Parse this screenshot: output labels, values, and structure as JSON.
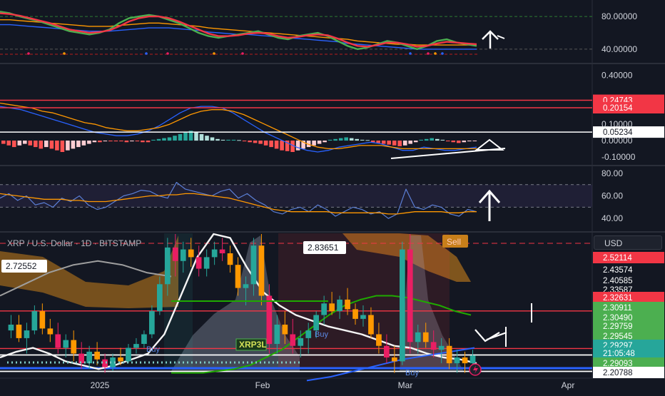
{
  "header": {
    "symbol_title": "XRP / U.S. Dollar · 1D · BITSTAMP",
    "currency": "USD"
  },
  "chart_data": [
    {
      "type": "line",
      "panel": "stochastic-oscillator",
      "ylim": [
        25,
        95
      ],
      "reference_lines": [
        80,
        40
      ],
      "tick_labels": [
        "80.00000",
        "40.00000"
      ],
      "series": [
        {
          "color": "#4caf50",
          "values": [
            86,
            84,
            80,
            77,
            74,
            70,
            66,
            62,
            60,
            58,
            60,
            64,
            72,
            78,
            80,
            82,
            80,
            76,
            72,
            66,
            60,
            56,
            54,
            56,
            58,
            60,
            62,
            58,
            54,
            52,
            56,
            58,
            60,
            56,
            50,
            44,
            40,
            42,
            46,
            50,
            48,
            44,
            40,
            44,
            50,
            52,
            48,
            46,
            44
          ]
        },
        {
          "color": "#f23645",
          "values": [
            84,
            83,
            81,
            78,
            75,
            72,
            68,
            64,
            62,
            60,
            61,
            63,
            68,
            74,
            78,
            80,
            80,
            78,
            74,
            69,
            64,
            59,
            56,
            56,
            57,
            59,
            60,
            59,
            56,
            54,
            55,
            57,
            58,
            57,
            53,
            48,
            44,
            43,
            45,
            48,
            48,
            46,
            43,
            44,
            47,
            49,
            48,
            47,
            46
          ]
        },
        {
          "color": "#2962ff",
          "values": [
            70,
            70,
            69,
            68,
            67,
            66,
            65,
            64,
            63,
            62,
            62,
            62,
            63,
            64,
            65,
            66,
            66,
            66,
            65,
            64,
            63,
            61,
            60,
            59,
            58,
            58,
            57,
            56,
            55,
            54,
            53,
            52,
            51,
            50,
            49,
            47,
            46,
            45,
            44,
            43,
            42,
            41,
            40,
            40,
            40,
            40,
            40,
            40,
            40
          ]
        },
        {
          "color": "#ff9800",
          "values": [
            76,
            76,
            75,
            74,
            73,
            72,
            71,
            70,
            69,
            68,
            68,
            68,
            69,
            70,
            71,
            72,
            72,
            71,
            70,
            69,
            68,
            66,
            65,
            64,
            63,
            62,
            61,
            60,
            59,
            58,
            57,
            56,
            55,
            54,
            53,
            52,
            50,
            49,
            48,
            47,
            46,
            46,
            45,
            45,
            45,
            45,
            45,
            45,
            45
          ]
        }
      ]
    },
    {
      "type": "bar",
      "panel": "macd",
      "ylim": [
        -0.14,
        0.46
      ],
      "tick_labels": [
        "0.40000",
        "0.10000",
        "0.00000",
        "-0.10000"
      ],
      "reference_lines": [
        {
          "value": 0.24743,
          "label": "0.24743",
          "color": "#f23645"
        },
        {
          "value": 0.20154,
          "label": "0.20154",
          "color": "#f23645"
        },
        {
          "value": 0.05234,
          "label": "0.05234",
          "color": "#ffffff"
        }
      ],
      "histogram": [
        -0.02,
        -0.03,
        -0.04,
        -0.03,
        -0.02,
        -0.03,
        -0.04,
        -0.05,
        -0.04,
        -0.05,
        -0.06,
        -0.07,
        -0.06,
        -0.05,
        -0.04,
        -0.03,
        -0.02,
        -0.01,
        -0.01,
        -0.005,
        -0.005,
        -0.005,
        -0.005,
        -0.01,
        -0.005,
        -0.005,
        -0.01,
        -0.01,
        0.005,
        0.01,
        0.015,
        0.02,
        0.03,
        0.04,
        0.05,
        0.06,
        0.055,
        0.04,
        0.03,
        0.02,
        0.01,
        0.005,
        0.005,
        0.005,
        0.003,
        -0.005,
        -0.01,
        -0.015,
        -0.02,
        -0.03,
        -0.04,
        -0.05,
        -0.06,
        -0.065,
        -0.07,
        -0.06,
        -0.05,
        -0.04,
        -0.03,
        -0.02,
        -0.01,
        0.005,
        0.01,
        0.015,
        0.02,
        0.015,
        0.01,
        0.005,
        0.003,
        -0.01,
        -0.015,
        -0.02,
        -0.025,
        -0.03,
        -0.035,
        -0.03,
        -0.02,
        -0.01,
        0.005,
        0.01,
        0.015,
        0.01,
        0.005,
        -0.005,
        -0.01,
        -0.015,
        -0.01,
        -0.005,
        -0.003
      ],
      "series": [
        {
          "color": "#2962ff",
          "values": [
            0.21,
            0.2,
            0.19,
            0.17,
            0.15,
            0.13,
            0.11,
            0.09,
            0.07,
            0.05,
            0.04,
            0.03,
            0.03,
            0.04,
            0.06,
            0.09,
            0.13,
            0.17,
            0.2,
            0.21,
            0.21,
            0.2,
            0.17,
            0.13,
            0.09,
            0.05,
            0.02,
            -0.01,
            -0.04,
            -0.06,
            -0.07,
            -0.06,
            -0.04,
            -0.03,
            -0.02,
            -0.01,
            -0.02,
            -0.04,
            -0.06,
            -0.06,
            -0.04,
            -0.05,
            -0.06,
            -0.06,
            -0.05,
            -0.04
          ]
        },
        {
          "color": "#ff9800",
          "values": [
            0.23,
            0.22,
            0.21,
            0.2,
            0.18,
            0.17,
            0.15,
            0.13,
            0.11,
            0.1,
            0.08,
            0.07,
            0.06,
            0.06,
            0.07,
            0.08,
            0.1,
            0.13,
            0.16,
            0.18,
            0.19,
            0.19,
            0.18,
            0.16,
            0.13,
            0.1,
            0.07,
            0.04,
            0.01,
            -0.02,
            -0.04,
            -0.05,
            -0.05,
            -0.04,
            -0.03,
            -0.03,
            -0.03,
            -0.04,
            -0.05,
            -0.05,
            -0.05,
            -0.05,
            -0.05,
            -0.05,
            -0.05,
            -0.05
          ]
        }
      ]
    },
    {
      "type": "line",
      "panel": "rsi",
      "ylim": [
        30,
        85
      ],
      "tick_labels": [
        "80.00",
        "60.00",
        "40.00"
      ],
      "reference_lines": [
        70,
        50
      ],
      "series": [
        {
          "color": "#5b7fd6",
          "values": [
            58,
            62,
            56,
            60,
            52,
            54,
            50,
            58,
            55,
            60,
            52,
            48,
            50,
            55,
            60,
            62,
            65,
            64,
            60,
            58,
            72,
            66,
            64,
            62,
            60,
            64,
            66,
            58,
            62,
            56,
            52,
            46,
            44,
            48,
            50,
            46,
            52,
            48,
            42,
            46,
            50,
            48,
            44,
            46,
            40,
            44,
            66,
            50,
            48,
            52,
            50,
            44,
            42,
            48,
            46
          ]
        },
        {
          "color": "#ff9800",
          "values": [
            62,
            61,
            60,
            59,
            58,
            57,
            57,
            57,
            56,
            56,
            55,
            55,
            55,
            56,
            57,
            58,
            59,
            60,
            60,
            61,
            61,
            62,
            62,
            61,
            60,
            59,
            58,
            56,
            54,
            52,
            50,
            48,
            47,
            46,
            46,
            46,
            46,
            46,
            45,
            45,
            45,
            45,
            45,
            45,
            44,
            44,
            45,
            46,
            46,
            46,
            46,
            45,
            45,
            46,
            46
          ]
        }
      ]
    },
    {
      "type": "candlestick",
      "panel": "price",
      "ylim": [
        2.18,
        2.92
      ],
      "x_ticks": [
        "2025",
        "Feb",
        "Mar",
        "Apr"
      ],
      "price_labels": [
        {
          "label": "2.52114",
          "kind": "red"
        },
        {
          "label": "2.43574",
          "kind": "plain"
        },
        {
          "label": "2.40585",
          "kind": "plain"
        },
        {
          "label": "2.33587",
          "kind": "plain"
        },
        {
          "label": "2.32631",
          "kind": "red"
        },
        {
          "label": "2.30911",
          "kind": "green"
        },
        {
          "label": "2.30490",
          "kind": "green"
        },
        {
          "label": "2.29759",
          "kind": "green"
        },
        {
          "label": "2.29545",
          "kind": "green"
        },
        {
          "label": "2.29297",
          "kind": "last"
        },
        {
          "label": "21:05:48",
          "kind": "timer"
        },
        {
          "label": "2.29093",
          "kind": "green"
        },
        {
          "label": "2.20788",
          "kind": "white"
        }
      ],
      "annotations": [
        {
          "text": "2.72552",
          "kind": "callout"
        },
        {
          "text": "2.83651",
          "kind": "callout"
        },
        {
          "text": "Sell",
          "kind": "signal"
        },
        {
          "text": "Buy",
          "kind": "signal"
        },
        {
          "text": "Buy",
          "kind": "signal"
        },
        {
          "text": "Buy",
          "kind": "signal"
        },
        {
          "text": "XRP3L",
          "kind": "tag"
        }
      ],
      "candles": [
        [
          2.42,
          2.5,
          2.38,
          2.45
        ],
        [
          2.45,
          2.5,
          2.36,
          2.38
        ],
        [
          2.38,
          2.46,
          2.3,
          2.42
        ],
        [
          2.42,
          2.55,
          2.4,
          2.52
        ],
        [
          2.52,
          2.56,
          2.4,
          2.43
        ],
        [
          2.43,
          2.48,
          2.36,
          2.4
        ],
        [
          2.4,
          2.46,
          2.3,
          2.33
        ],
        [
          2.33,
          2.4,
          2.28,
          2.37
        ],
        [
          2.37,
          2.42,
          2.26,
          2.3
        ],
        [
          2.3,
          2.36,
          2.22,
          2.25
        ],
        [
          2.25,
          2.34,
          2.22,
          2.31
        ],
        [
          2.31,
          2.36,
          2.24,
          2.27
        ],
        [
          2.27,
          2.3,
          2.2,
          2.23
        ],
        [
          2.23,
          2.3,
          2.21,
          2.28
        ],
        [
          2.28,
          2.33,
          2.24,
          2.26
        ],
        [
          2.26,
          2.35,
          2.25,
          2.33
        ],
        [
          2.33,
          2.38,
          2.3,
          2.35
        ],
        [
          2.35,
          2.42,
          2.33,
          2.4
        ],
        [
          2.4,
          2.55,
          2.38,
          2.52
        ],
        [
          2.52,
          2.7,
          2.5,
          2.66
        ],
        [
          2.66,
          2.9,
          2.6,
          2.85
        ],
        [
          2.85,
          2.92,
          2.7,
          2.78
        ],
        [
          2.78,
          2.88,
          2.72,
          2.84
        ],
        [
          2.84,
          2.9,
          2.75,
          2.8
        ],
        [
          2.8,
          2.86,
          2.7,
          2.74
        ],
        [
          2.74,
          2.84,
          2.7,
          2.8
        ],
        [
          2.8,
          2.88,
          2.76,
          2.84
        ],
        [
          2.84,
          2.9,
          2.78,
          2.82
        ],
        [
          2.82,
          2.86,
          2.72,
          2.76
        ],
        [
          2.76,
          2.8,
          2.6,
          2.64
        ],
        [
          2.64,
          2.7,
          2.55,
          2.66
        ],
        [
          2.66,
          2.9,
          2.6,
          2.86
        ],
        [
          2.86,
          2.92,
          2.55,
          2.6
        ],
        [
          2.6,
          2.66,
          2.3,
          2.35
        ],
        [
          2.35,
          2.5,
          2.3,
          2.45
        ],
        [
          2.45,
          2.52,
          2.35,
          2.4
        ],
        [
          2.4,
          2.48,
          2.3,
          2.34
        ],
        [
          2.34,
          2.42,
          2.28,
          2.38
        ],
        [
          2.38,
          2.46,
          2.3,
          2.42
        ],
        [
          2.42,
          2.52,
          2.38,
          2.5
        ],
        [
          2.5,
          2.6,
          2.45,
          2.56
        ],
        [
          2.56,
          2.62,
          2.5,
          2.52
        ],
        [
          2.52,
          2.6,
          2.48,
          2.58
        ],
        [
          2.58,
          2.64,
          2.5,
          2.53
        ],
        [
          2.53,
          2.56,
          2.45,
          2.48
        ],
        [
          2.48,
          2.55,
          2.44,
          2.5
        ],
        [
          2.5,
          2.54,
          2.38,
          2.4
        ],
        [
          2.4,
          2.46,
          2.3,
          2.34
        ],
        [
          2.34,
          2.4,
          2.25,
          2.28
        ],
        [
          2.28,
          2.34,
          2.2,
          2.26
        ],
        [
          2.26,
          2.88,
          2.24,
          2.84
        ],
        [
          2.84,
          2.92,
          2.3,
          2.36
        ],
        [
          2.36,
          2.45,
          2.3,
          2.41
        ],
        [
          2.41,
          2.46,
          2.33,
          2.36
        ],
        [
          2.36,
          2.42,
          2.28,
          2.32
        ],
        [
          2.32,
          2.38,
          2.25,
          2.34
        ],
        [
          2.34,
          2.38,
          2.22,
          2.25
        ],
        [
          2.25,
          2.32,
          2.2,
          2.28
        ],
        [
          2.28,
          2.31,
          2.2,
          2.25
        ],
        [
          2.25,
          2.32,
          2.22,
          2.29
        ]
      ]
    }
  ]
}
